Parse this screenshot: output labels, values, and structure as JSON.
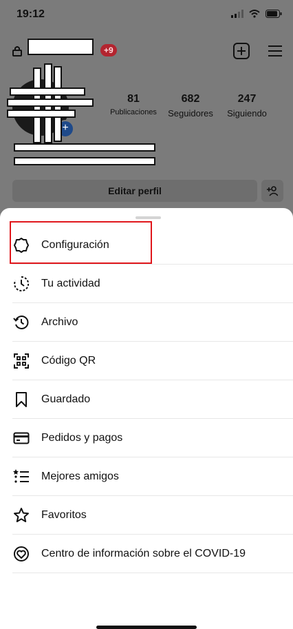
{
  "status_bar": {
    "time": "19:12"
  },
  "profile": {
    "notification_badge": "+9",
    "stats": [
      {
        "value": "81",
        "label": "Publicaciones"
      },
      {
        "value": "682",
        "label": "Seguidores"
      },
      {
        "value": "247",
        "label": "Siguiendo"
      }
    ],
    "edit_profile_label": "Editar perfil"
  },
  "menu": {
    "items": [
      {
        "label": "Configuración",
        "icon": "settings-icon"
      },
      {
        "label": "Tu actividad",
        "icon": "activity-icon"
      },
      {
        "label": "Archivo",
        "icon": "archive-icon"
      },
      {
        "label": "Código QR",
        "icon": "qr-code-icon"
      },
      {
        "label": "Guardado",
        "icon": "bookmark-icon"
      },
      {
        "label": "Pedidos y pagos",
        "icon": "card-icon"
      },
      {
        "label": "Mejores amigos",
        "icon": "close-friends-icon"
      },
      {
        "label": "Favoritos",
        "icon": "star-icon"
      },
      {
        "label": "Centro de información sobre el COVID-19",
        "icon": "covid-info-icon"
      }
    ],
    "highlight_color": "#e0161b"
  }
}
